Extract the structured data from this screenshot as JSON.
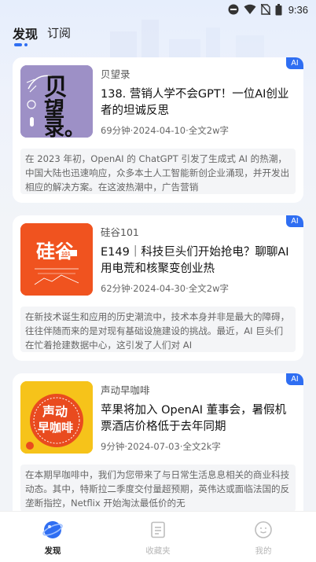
{
  "status_bar": {
    "time": "9:36"
  },
  "tabs": [
    {
      "label": "发现"
    },
    {
      "label": "订阅"
    }
  ],
  "ai_badge": "AI",
  "cards": [
    {
      "cover_text": "贝望录。",
      "source": "贝望录",
      "title": "138. 营销人学不会GPT！一位AI创业者的坦诚反思",
      "info": "69分钟·2024-04-10·全文2w字",
      "summary": "在 2023 年初，OpenAI 的 ChatGPT 引发了生成式 AI 的热潮，中国大陆也迅速响应，众多本土人工智能新创企业涌现，并开发出相应的解决方案。在这波热潮中，广告营销"
    },
    {
      "cover_text": "硅谷101",
      "source": "硅谷101",
      "title": "E149｜科技巨头们开始抢电？聊聊AI用电荒和核聚变创业热",
      "info": "62分钟·2024-04-30·全文2w字",
      "summary": "在新技术诞生和应用的历史潮流中，技术本身并非是最大的障碍，往往伴随而来的是对现有基础设施建设的挑战。最近，AI 巨头们在忙着抢建数据中心，这引发了人们对 AI"
    },
    {
      "cover_text": "声动早咖啡",
      "source": "声动早咖啡",
      "title": "苹果将加入 OpenAI 董事会，暑假机票酒店价格低于去年同期",
      "info": "9分钟·2024-07-03·全文2k字",
      "summary": "在本期早咖啡中，我们为您带来了与日常生活息息相关的商业科技动态。其中，特斯拉二季度交付量超预期，英伟达或面临法国的反垄断指控，Netflix 开始淘汰最低价的无"
    }
  ],
  "bottom_nav": [
    {
      "label": "发现"
    },
    {
      "label": "收藏夹"
    },
    {
      "label": "我的"
    }
  ],
  "colors": {
    "accent": "#2f6ef2",
    "card_bg": "#ffffff",
    "summary_bg": "#f4f5f7"
  }
}
